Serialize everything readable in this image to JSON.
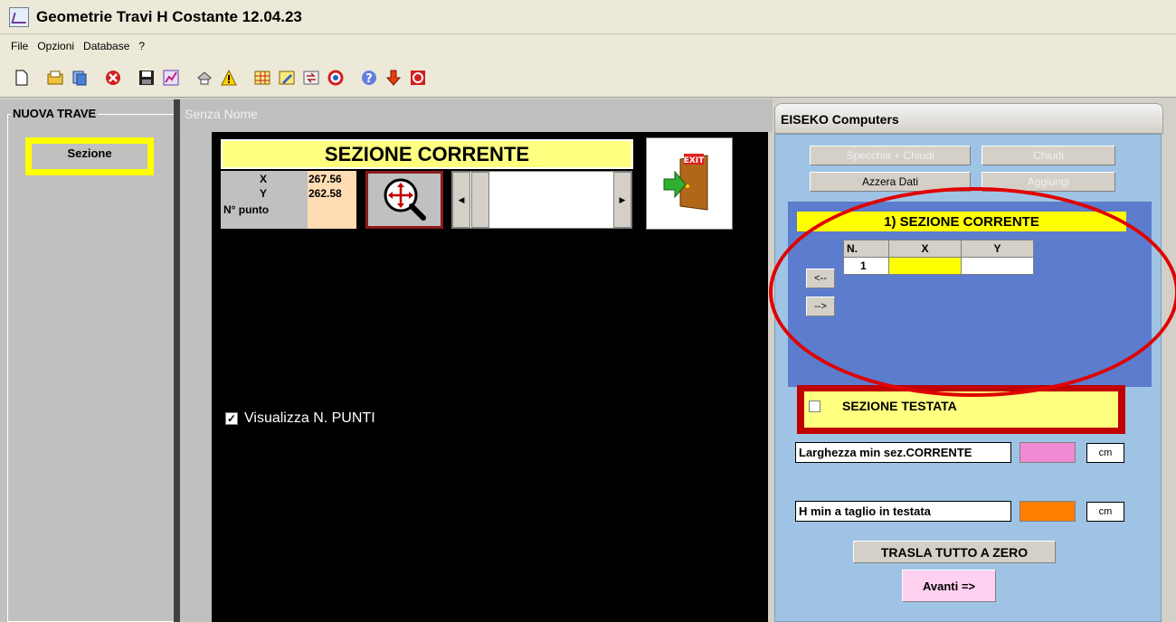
{
  "window": {
    "title": "Geometrie Travi H Costante 12.04.23"
  },
  "menu": [
    {
      "label": "File"
    },
    {
      "label": "Opzioni"
    },
    {
      "label": "Database"
    },
    {
      "label": "?"
    }
  ],
  "toolbar": {
    "icons": [
      "new-file-icon",
      "open-icon",
      "copy-icon",
      "delete-icon",
      "save-icon",
      "chart-icon",
      "print-icon",
      "warning-icon",
      "grid-icon",
      "edit-icon",
      "transform-icon",
      "refresh-icon",
      "help-icon",
      "download-icon",
      "stop-icon"
    ]
  },
  "left_panel": {
    "frame_label": "NUOVA TRAVE",
    "sezione_button": "Sezione"
  },
  "document": {
    "title": "Senza Nome",
    "section_header": "SEZIONE CORRENTE",
    "coords": {
      "x_label": "X",
      "x_value": "267.56",
      "y_label": "Y",
      "y_value": "262.58",
      "punto_label": "N° punto"
    },
    "visualizza_label": "Visualizza N. PUNTI",
    "visualizza_checked": true
  },
  "right_panel": {
    "title": "EISEKO Computers",
    "buttons": {
      "specchia": "Specchia + Chiudi",
      "chiudi": "Chiudi",
      "azzera": "Azzera Dati",
      "aggiungi": "Aggiungi"
    },
    "section_header": "1) SEZIONE CORRENTE",
    "grid": {
      "headers": [
        "N.",
        "X",
        "Y"
      ],
      "rows": [
        {
          "n": "1",
          "x": "",
          "y": ""
        }
      ]
    },
    "nav": {
      "prev": "<--",
      "next": "-->"
    },
    "testata_label": "SEZIONE TESTATA",
    "larghezza_label": "Larghezza min sez.CORRENTE",
    "larghezza_unit": "cm",
    "h_min_label": "H min a taglio in testata",
    "h_min_unit": "cm",
    "trasla_button": "TRASLA TUTTO A ZERO",
    "avanti_button": "Avanti =>"
  },
  "colors": {
    "highlight_yellow": "#ffff00",
    "pale_yellow": "#ffff80",
    "panel_blue": "#5c7ccd",
    "annotation_red": "#e00000",
    "pink_field": "#f08ad4",
    "orange_field": "#ff8000"
  }
}
